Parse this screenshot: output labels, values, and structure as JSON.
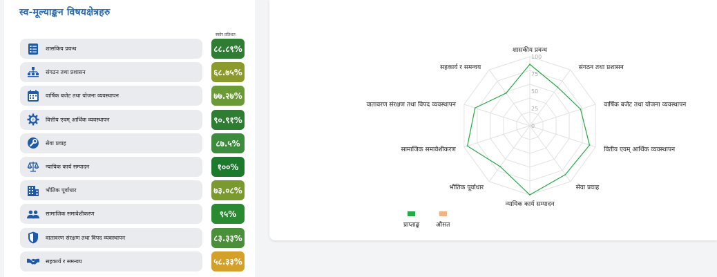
{
  "panel": {
    "title": "स्व-मूल्याङ्कन विषयक्षेत्रहरु",
    "score_header": "स्कोर प्रतिशत"
  },
  "items": [
    {
      "label": "शासकिय प्रवन्ध",
      "score": "८८.८९%",
      "color": "#2e7d32",
      "icon": "clipboard-list-icon"
    },
    {
      "label": "संगठन तथा प्रशासन",
      "score": "६८.७५%",
      "color": "#8c9a2b",
      "icon": "org-chart-icon"
    },
    {
      "label": "वार्षिक बजेट तथा योजना व्यवस्थापन",
      "score": "७७.२७%",
      "color": "#6a9a35",
      "icon": "calendar-icon"
    },
    {
      "label": "वित्तीय एवम् आर्थिक व्यवस्थापन",
      "score": "९०.९१%",
      "color": "#2e7d32",
      "icon": "finance-gear-icon"
    },
    {
      "label": "सेवा प्रवाह",
      "score": "८७.५%",
      "color": "#3d8b3d",
      "icon": "service-wrench-icon"
    },
    {
      "label": "न्यायिक कार्य सम्पादन",
      "score": "१००%",
      "color": "#1b7a2b",
      "icon": "scales-icon"
    },
    {
      "label": "भौतिक पूर्वाधार",
      "score": "७३.०८%",
      "color": "#7a9a30",
      "icon": "building-icon"
    },
    {
      "label": "सामाजिक समावेशीकरण",
      "score": "९५%",
      "color": "#2a8a32",
      "icon": "people-icon"
    },
    {
      "label": "वातावरण संरक्षण तथा विपद व्यवस्थापन",
      "score": "८३.३३%",
      "color": "#4a8f3a",
      "icon": "shield-icon"
    },
    {
      "label": "सहकार्य र समन्वय",
      "score": "५८.३३%",
      "color": "#d4a02a",
      "icon": "handshake-icon"
    }
  ],
  "chart_data": {
    "type": "radar",
    "categories": [
      "शासकीय प्रवन्ध",
      "संगठन तथा प्रशासन",
      "वार्षिक बजेट तथा योजना व्यवस्थापन",
      "वितीय एवम् आर्थिक व्यवस्थापन",
      "सेवा प्रवाह",
      "न्यायिक कार्य सम्पादन",
      "भौतिक पूर्वाधार",
      "सामाजिक समावेशीकरण",
      "वातावरण संरक्षण तथा विपद व्यवस्थापन",
      "सहकार्य र समन्वय"
    ],
    "series": [
      {
        "name": "प्राप्ताङ्क",
        "color": "#22aa44",
        "values": [
          88.89,
          68.75,
          77.27,
          90.91,
          87.5,
          100,
          73.08,
          95,
          83.33,
          58.33
        ]
      },
      {
        "name": "औसत",
        "color": "#f4b183",
        "values": []
      }
    ],
    "rlim": [
      0,
      100
    ],
    "ticks": [
      "0",
      "25",
      "50",
      "75",
      "100"
    ],
    "grid": true,
    "legend_position": "bottom-left"
  }
}
